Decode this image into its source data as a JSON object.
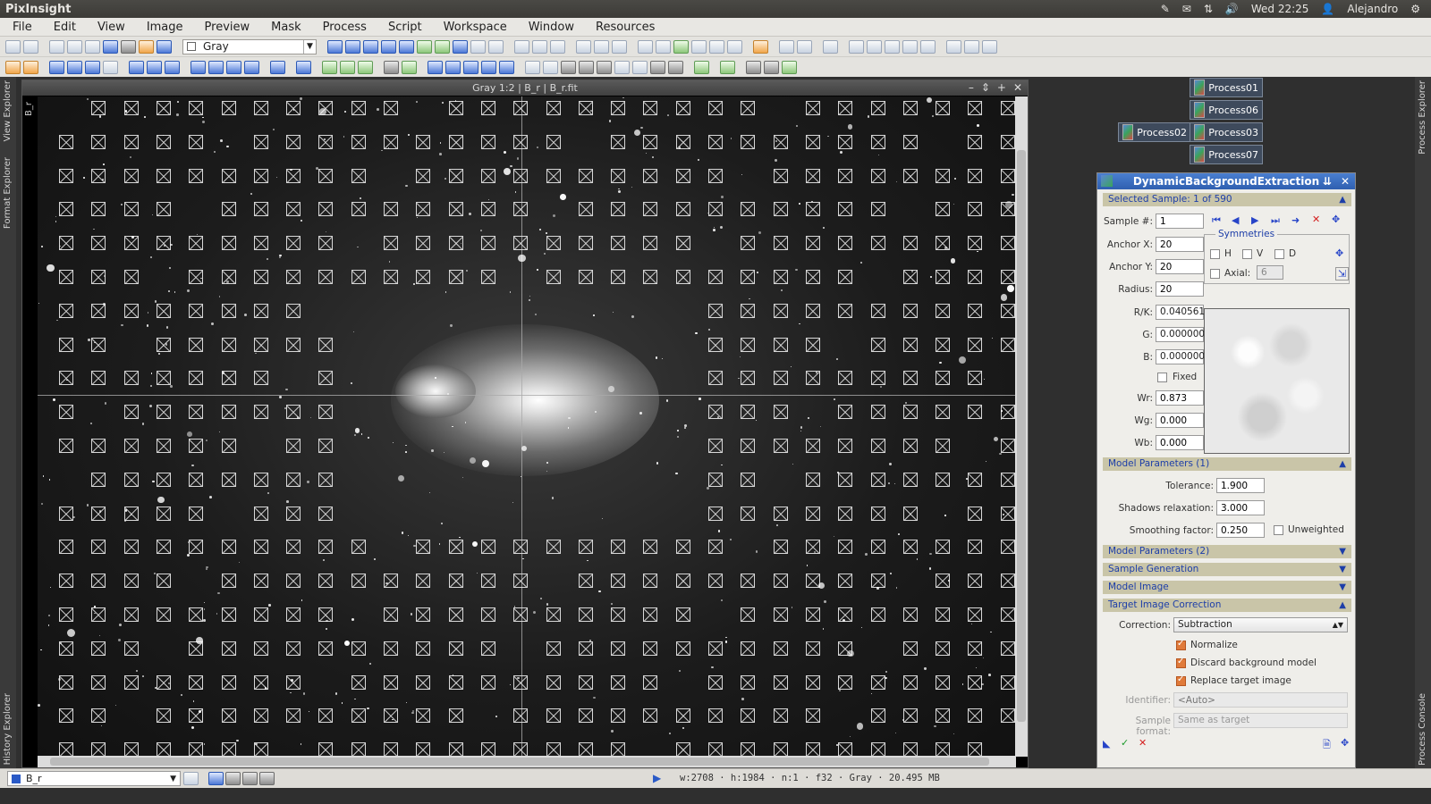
{
  "system": {
    "app_name": "PixInsight",
    "clock": "Wed 22:25",
    "user": "Alejandro"
  },
  "menu": [
    "File",
    "Edit",
    "View",
    "Image",
    "Preview",
    "Mask",
    "Process",
    "Script",
    "Workspace",
    "Window",
    "Resources"
  ],
  "toolbar": {
    "colorspace_value": "Gray"
  },
  "side_tabs": {
    "left_top": "View Explorer",
    "left_mid": "Format Explorer",
    "left_bottom": "History Explorer",
    "right_top": "Process Explorer",
    "right_bottom": "Process Console"
  },
  "image_window": {
    "title": "Gray 1:2 | B_r | B_r.fit",
    "side_label": "B_r"
  },
  "process_icons": [
    "Process01",
    "Process06",
    "Process02",
    "Process03",
    "Process07"
  ],
  "dbe": {
    "title": "DynamicBackgroundExtraction",
    "sec_selected": "Selected Sample: 1 of 590",
    "sample_label": "Sample #:",
    "sample_value": "1",
    "anchor_x_label": "Anchor X:",
    "anchor_x": "20",
    "anchor_y_label": "Anchor Y:",
    "anchor_y": "20",
    "radius_label": "Radius:",
    "radius": "20",
    "rk_label": "R/K:",
    "rk": "0.040561",
    "g_label": "G:",
    "g": "0.000000",
    "b_label": "B:",
    "b": "0.000000",
    "fixed_label": "Fixed",
    "wr_label": "Wr:",
    "wr": "0.873",
    "wg_label": "Wg:",
    "wg": "0.000",
    "wb_label": "Wb:",
    "wb": "0.000",
    "symmetries_label": "Symmetries",
    "sym_h": "H",
    "sym_v": "V",
    "sym_d": "D",
    "axial_label": "Axial:",
    "axial_value": "6",
    "sec_model1": "Model Parameters (1)",
    "tolerance_label": "Tolerance:",
    "tolerance": "1.900",
    "shadows_label": "Shadows relaxation:",
    "shadows": "3.000",
    "smoothing_label": "Smoothing factor:",
    "smoothing": "0.250",
    "unweighted_label": "Unweighted",
    "sec_model2": "Model Parameters (2)",
    "sec_sample_gen": "Sample Generation",
    "sec_model_image": "Model Image",
    "sec_target": "Target Image Correction",
    "correction_label": "Correction:",
    "correction_value": "Subtraction",
    "normalize_label": "Normalize",
    "discard_label": "Discard background model",
    "replace_label": "Replace target image",
    "identifier_label": "Identifier:",
    "identifier_placeholder": "<Auto>",
    "sample_format_label": "Sample format:",
    "sample_format_value": "Same as target"
  },
  "statusbar": {
    "view_selector": "B_r",
    "info": "w:2708 · h:1984 · n:1 · f32 · Gray · 20.495 MB"
  },
  "colors": {
    "dbe_title": "#2f5fb0",
    "section_bg": "#c9c5a8",
    "section_text": "#1d3ea8",
    "checkbox_on": "#e07a3a"
  }
}
